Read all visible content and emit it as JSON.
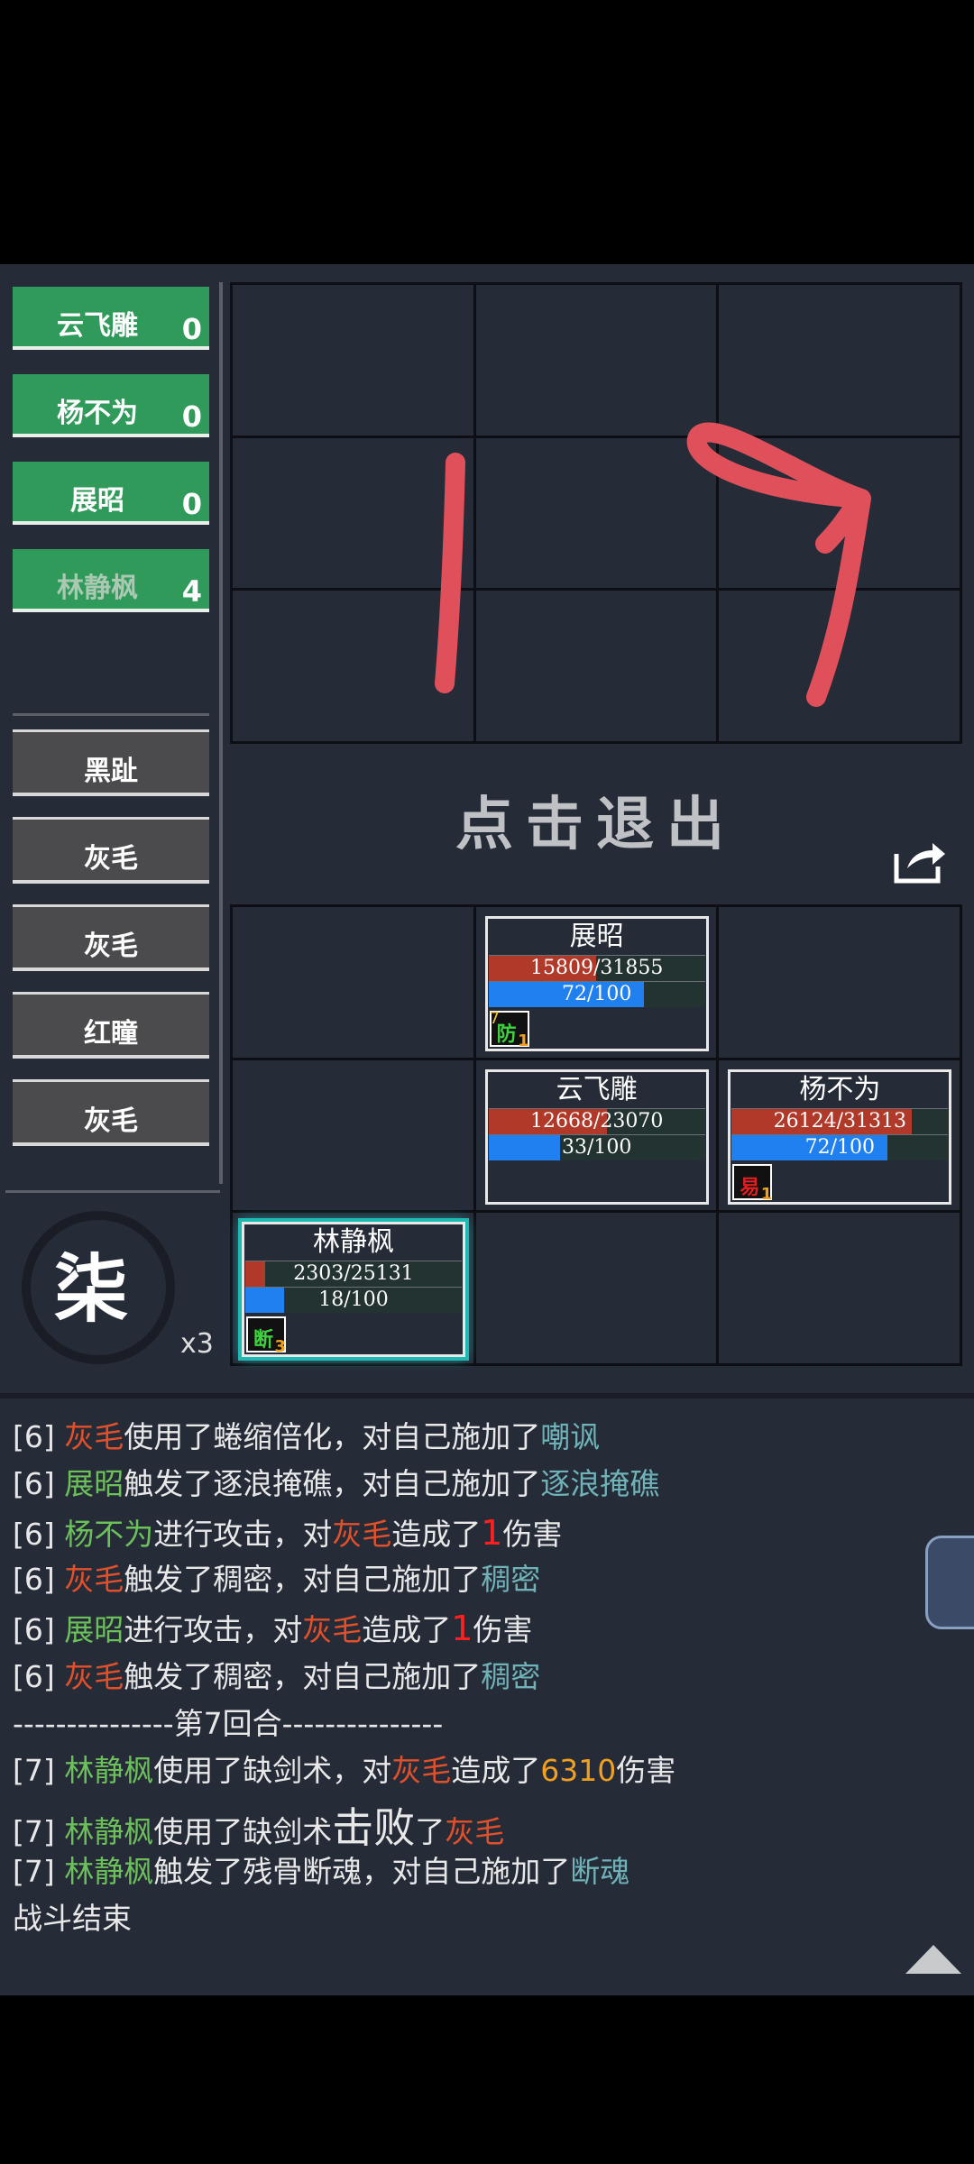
{
  "party": [
    {
      "name": "云飞雕",
      "count": "0"
    },
    {
      "name": "杨不为",
      "count": "0"
    },
    {
      "name": "展昭",
      "count": "0"
    },
    {
      "name": "林静枫",
      "count": "4"
    }
  ],
  "enemies": [
    "黑趾",
    "灰毛",
    "灰毛",
    "红瞳",
    "灰毛"
  ],
  "turn_glyph": "柒",
  "turn_multiplier": "x3",
  "exit_label": "点击退出",
  "scribble": "1 9",
  "units": {
    "zhanzhao": {
      "name": "展昭",
      "hp": "15809/31855",
      "hp_pct": 49.6,
      "mp": "72/100",
      "mp_pct": 72,
      "buff": "防",
      "buff_left": "7",
      "buff_count": "1",
      "buff_color": "#3fd23f"
    },
    "yunfeidiao": {
      "name": "云飞雕",
      "hp": "12668/23070",
      "hp_pct": 54.9,
      "mp": "33/100",
      "mp_pct": 33
    },
    "yangbuwei": {
      "name": "杨不为",
      "hp": "26124/31313",
      "hp_pct": 83.4,
      "mp": "72/100",
      "mp_pct": 72,
      "buff": "易",
      "buff_count": "1",
      "buff_color": "#e02020"
    },
    "linjingfeng": {
      "name": "林静枫",
      "hp": "2303/25131",
      "hp_pct": 9.2,
      "mp": "18/100",
      "mp_pct": 18,
      "buff": "断",
      "buff_count": "3",
      "buff_color": "#3fd23f"
    }
  },
  "log": {
    "l1": {
      "tag": "[6] ",
      "a": "灰毛",
      "b": "使用了蜷缩倍化，对自己施加了",
      "c": "嘲讽"
    },
    "l2": {
      "tag": "[6] ",
      "a": "展昭",
      "b": "触发了逐浪掩礁，对自己施加了",
      "c": "逐浪掩礁"
    },
    "l3": {
      "tag": "[6] ",
      "a": "杨不为",
      "b": "进行攻击，对",
      "c": "灰毛",
      "d": "造成了",
      "e": "1",
      "f": "伤害"
    },
    "l4": {
      "tag": "[6] ",
      "a": "灰毛",
      "b": "触发了稠密，对自己施加了",
      "c": "稠密"
    },
    "l5": {
      "tag": "[6] ",
      "a": "展昭",
      "b": "进行攻击，对",
      "c": "灰毛",
      "d": "造成了",
      "e": "1",
      "f": "伤害"
    },
    "l6": {
      "tag": "[6] ",
      "a": "灰毛",
      "b": "触发了稠密，对自己施加了",
      "c": "稠密"
    },
    "l7": {
      "text": "---------------第7回合---------------"
    },
    "l8": {
      "tag": "[7] ",
      "a": "林静枫",
      "b": "使用了缺剑术，对",
      "c": "灰毛",
      "d": "造成了",
      "e": "6310",
      "f": "伤害"
    },
    "l9": {
      "tag": "[7] ",
      "a": "林静枫",
      "b": "使用了缺剑术",
      "big": "击败",
      "d": "了",
      "c": "灰毛"
    },
    "l10": {
      "tag": "[7] ",
      "a": "林静枫",
      "b": "触发了残骨断魂，对自己施加了",
      "c": "断魂"
    },
    "l11": {
      "text": "战斗结束"
    }
  }
}
